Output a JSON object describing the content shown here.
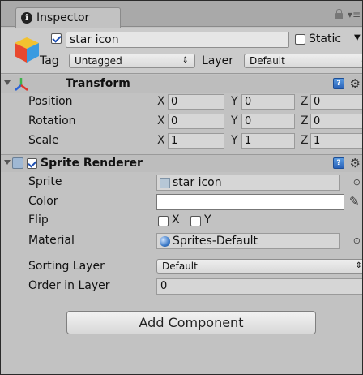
{
  "tab": {
    "title": "Inspector",
    "menu_glyph": "▾≡"
  },
  "gameobject": {
    "active": true,
    "name": "star icon",
    "static_label": "Static",
    "static_checked": false,
    "tag_label": "Tag",
    "tag_value": "Untagged",
    "layer_label": "Layer",
    "layer_value": "Default"
  },
  "transform": {
    "title": "Transform",
    "rows": [
      {
        "label": "Position",
        "x": "0",
        "y": "0",
        "z": "0"
      },
      {
        "label": "Rotation",
        "x": "0",
        "y": "0",
        "z": "0"
      },
      {
        "label": "Scale",
        "x": "1",
        "y": "1",
        "z": "1"
      }
    ],
    "axes": {
      "x": "X",
      "y": "Y",
      "z": "Z"
    }
  },
  "sprite_renderer": {
    "title": "Sprite Renderer",
    "enabled": true,
    "sprite_label": "Sprite",
    "sprite_value": "star icon",
    "color_label": "Color",
    "color_value": "#ffffff",
    "flip_label": "Flip",
    "flip_x_label": "X",
    "flip_y_label": "Y",
    "material_label": "Material",
    "material_value": "Sprites-Default",
    "sorting_layer_label": "Sorting Layer",
    "sorting_layer_value": "Default",
    "order_label": "Order in Layer",
    "order_value": "0"
  },
  "add_component_label": "Add Component"
}
